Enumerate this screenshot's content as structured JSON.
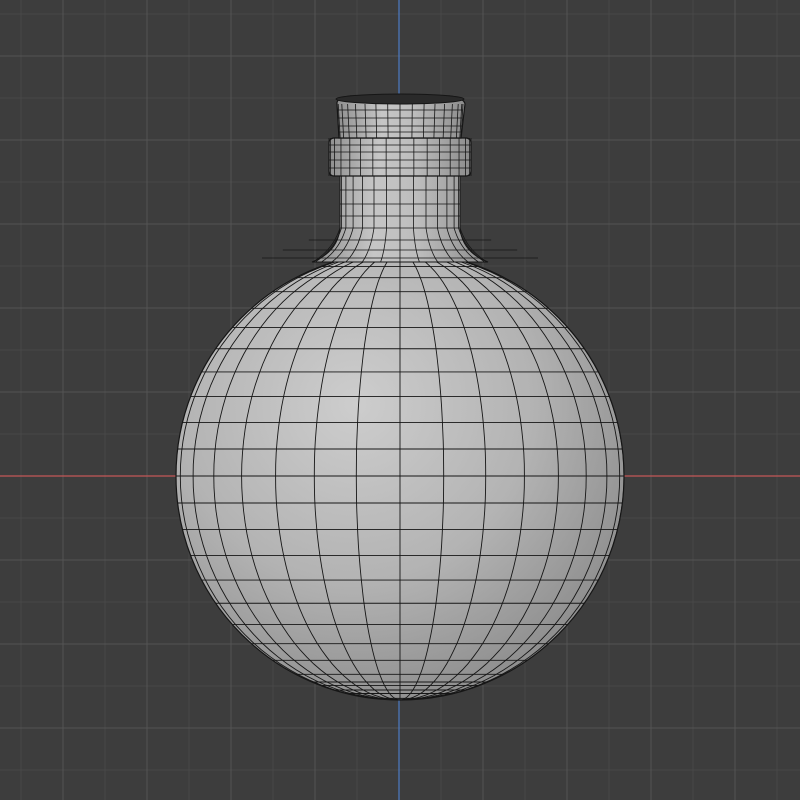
{
  "viewport": {
    "view": "front-orthographic",
    "background_color": "#3d3d3d",
    "grid": {
      "minor_color": "#484848",
      "major_color": "#535353"
    },
    "axes": {
      "x_axis_color": "#c45757",
      "z_axis_color": "#4c7bc4"
    }
  },
  "model": {
    "object": "flask",
    "parts": [
      "round-body",
      "neck",
      "collar-ring",
      "cork"
    ],
    "shading": "solid",
    "overlay": "wireframe",
    "surface_color": "#b9b9b9",
    "wire_color": "#161616"
  }
}
